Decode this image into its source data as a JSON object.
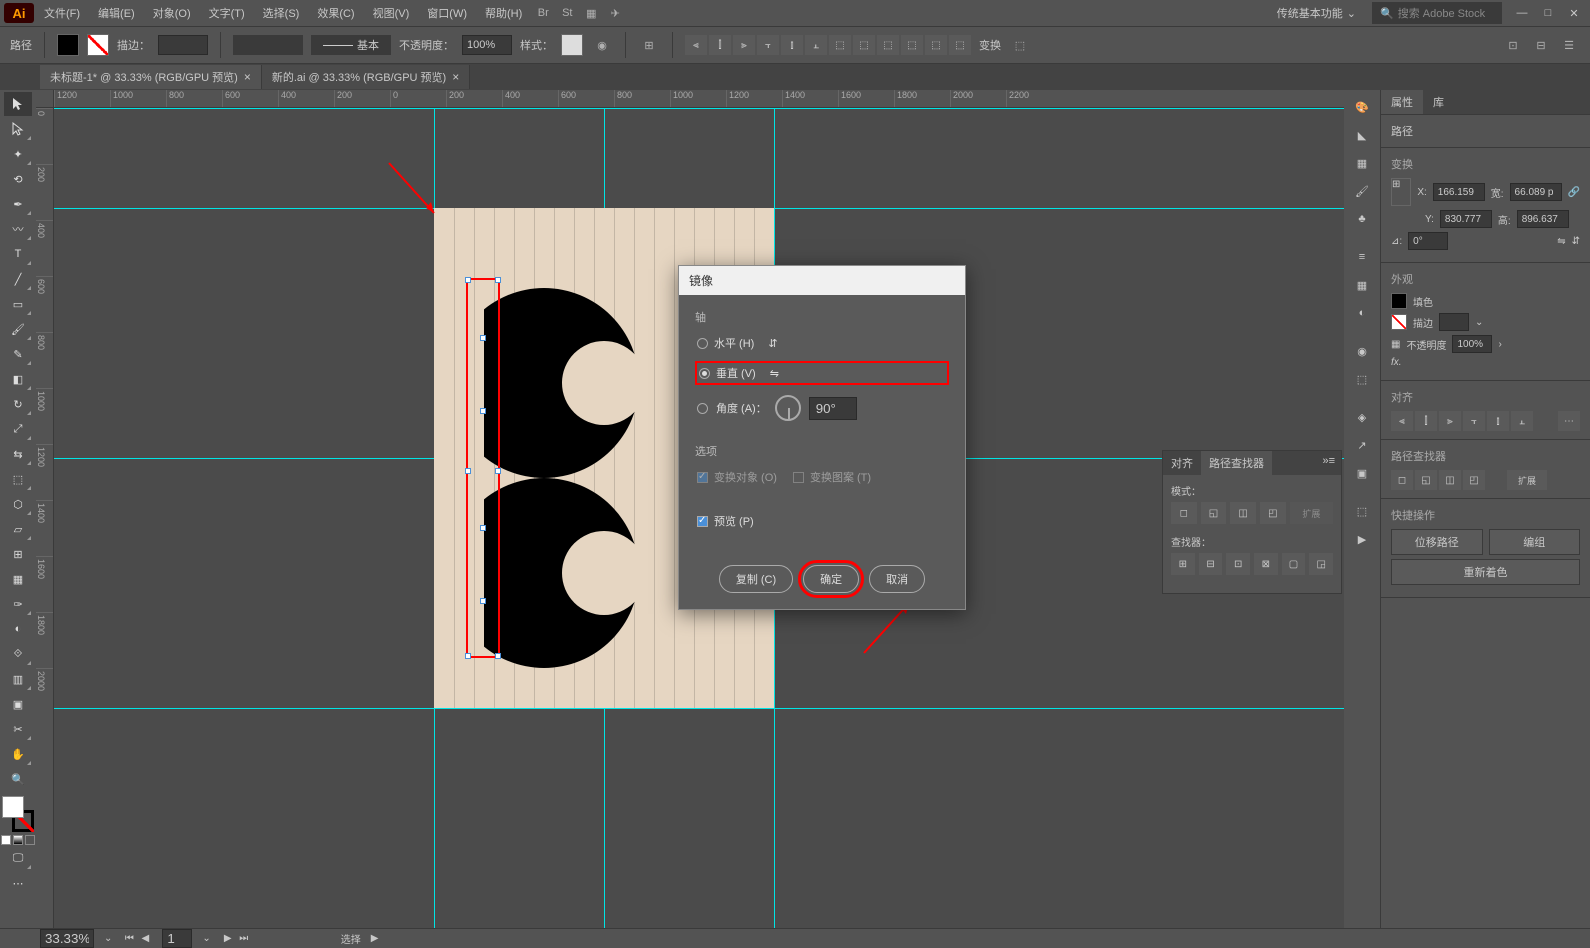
{
  "menubar": {
    "logo": "Ai",
    "items": [
      "文件(F)",
      "编辑(E)",
      "对象(O)",
      "文字(T)",
      "选择(S)",
      "效果(C)",
      "视图(V)",
      "窗口(W)",
      "帮助(H)"
    ],
    "workspace": "传统基本功能",
    "search_placeholder": "搜索 Adobe Stock"
  },
  "controlbar": {
    "label": "路径",
    "stroke_label": "描边：",
    "stroke_value": "",
    "brush_label": "基本",
    "opacity_label": "不透明度：",
    "opacity_value": "100%",
    "style_label": "样式：",
    "transform_label": "变换"
  },
  "tabs": [
    {
      "label": "未标题-1* @ 33.33% (RGB/GPU 预览)",
      "active": true
    },
    {
      "label": "新的.ai @ 33.33% (RGB/GPU 预览)",
      "active": false
    }
  ],
  "ruler_h": [
    "1200",
    "1000",
    "800",
    "600",
    "400",
    "200",
    "0",
    "200",
    "400",
    "600",
    "800",
    "1000",
    "1200",
    "1400",
    "1600",
    "1800",
    "2000",
    "2200"
  ],
  "ruler_v": [
    "0",
    "200",
    "400",
    "600",
    "800",
    "1000",
    "1200",
    "1400",
    "1600",
    "1800",
    "2000"
  ],
  "dialog": {
    "title": "镜像",
    "axis_label": "轴",
    "horizontal": "水平 (H)",
    "vertical": "垂直 (V)",
    "angle_label": "角度 (A)：",
    "angle_value": "90°",
    "options_label": "选项",
    "swap_objects": "变换对象 (O)",
    "swap_patterns": "变换图案 (T)",
    "preview": "预览 (P)",
    "copy_btn": "复制 (C)",
    "ok_btn": "确定",
    "cancel_btn": "取消"
  },
  "panels": {
    "tabs": [
      "属性",
      "库"
    ],
    "object_type": "路径",
    "transform": {
      "title": "变换",
      "x_label": "X:",
      "x": "166.159",
      "y_label": "Y:",
      "y": "830.777",
      "w_label": "宽:",
      "w": "66.089 p",
      "h_label": "高:",
      "h": "896.637",
      "angle_label": "⊿:",
      "angle": "0°"
    },
    "appearance": {
      "title": "外观",
      "fill": "填色",
      "stroke": "描边",
      "opacity_label": "不透明度",
      "opacity": "100%",
      "fx": "fx."
    },
    "align": {
      "title": "对齐"
    },
    "pathfinder": {
      "title": "路径查找器",
      "expand": "扩展"
    },
    "quick": {
      "title": "快捷操作",
      "offset": "位移路径",
      "group": "编组",
      "recolor": "重新着色"
    }
  },
  "pathfinder_float": {
    "tabs": [
      "对齐",
      "路径查找器"
    ],
    "shape_modes": "模式：",
    "pathfinders": "查找器：",
    "expand": "扩展"
  },
  "statusbar": {
    "zoom": "33.33%",
    "artboard": "1",
    "tool": "选择"
  }
}
